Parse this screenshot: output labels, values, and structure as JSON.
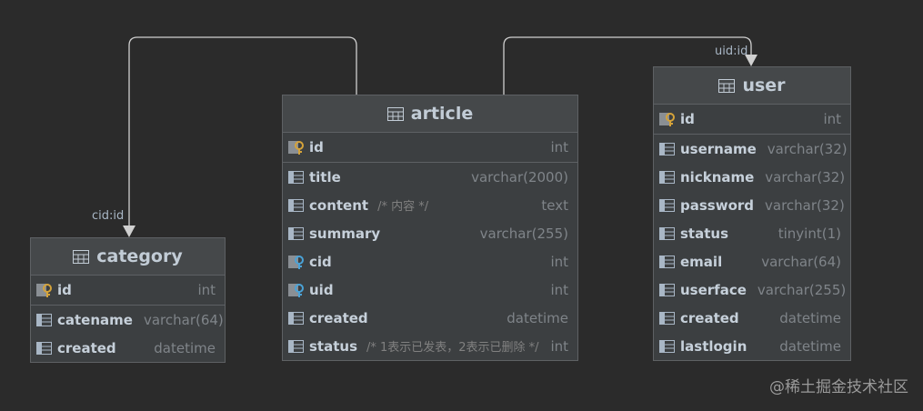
{
  "tables": {
    "article": {
      "title": "article",
      "pk": {
        "name": "id",
        "type": "int"
      },
      "columns": [
        {
          "name": "title",
          "type": "varchar(2000)",
          "comment": ""
        },
        {
          "name": "content",
          "type": "text",
          "comment": "/* 内容 */"
        },
        {
          "name": "summary",
          "type": "varchar(255)",
          "comment": ""
        },
        {
          "name": "cid",
          "type": "int",
          "comment": ""
        },
        {
          "name": "uid",
          "type": "int",
          "comment": ""
        },
        {
          "name": "created",
          "type": "datetime",
          "comment": ""
        },
        {
          "name": "status",
          "type": "int",
          "comment": "/* 1表示已发表，2表示已删除 */"
        }
      ]
    },
    "category": {
      "title": "category",
      "pk": {
        "name": "id",
        "type": "int"
      },
      "columns": [
        {
          "name": "catename",
          "type": "varchar(64)",
          "comment": ""
        },
        {
          "name": "created",
          "type": "datetime",
          "comment": ""
        }
      ]
    },
    "user": {
      "title": "user",
      "pk": {
        "name": "id",
        "type": "int"
      },
      "columns": [
        {
          "name": "username",
          "type": "varchar(32)",
          "comment": ""
        },
        {
          "name": "nickname",
          "type": "varchar(32)",
          "comment": ""
        },
        {
          "name": "password",
          "type": "varchar(32)",
          "comment": ""
        },
        {
          "name": "status",
          "type": "tinyint(1)",
          "comment": ""
        },
        {
          "name": "email",
          "type": "varchar(64)",
          "comment": ""
        },
        {
          "name": "userface",
          "type": "varchar(255)",
          "comment": ""
        },
        {
          "name": "created",
          "type": "datetime",
          "comment": ""
        },
        {
          "name": "lastlogin",
          "type": "datetime",
          "comment": ""
        }
      ]
    }
  },
  "relations": {
    "cid_label": "cid:id",
    "uid_label": "uid:id"
  },
  "watermark": "@稀土掘金技术社区",
  "icons": {
    "table": "table-icon",
    "pk": "primary-key-icon",
    "fk": "foreign-key-icon",
    "column": "column-icon"
  },
  "colors": {
    "background": "#2b2b2b",
    "table_body": "#3c3f41",
    "key_gold": "#d5a33a",
    "key_blue": "#4aa3d8",
    "connector": "#d0d0d0"
  }
}
